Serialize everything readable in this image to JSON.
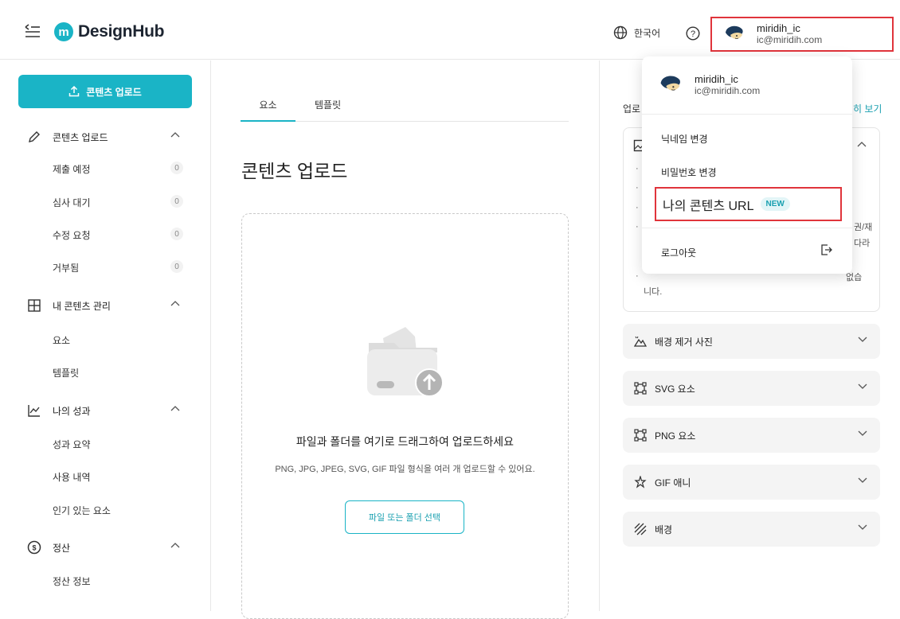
{
  "header": {
    "logo_text": "DesignHub",
    "logo_mark": "m",
    "lang_label": "한국어",
    "user_name": "miridih_ic",
    "user_email": "ic@miridih.com"
  },
  "sidebar": {
    "upload_label": "콘텐츠 업로드",
    "sections": [
      {
        "label": "콘텐츠 업로드",
        "icon": "pencil-icon",
        "items": [
          {
            "label": "제출 예정",
            "count": "0"
          },
          {
            "label": "심사 대기",
            "count": "0"
          },
          {
            "label": "수정 요청",
            "count": "0"
          },
          {
            "label": "거부됨",
            "count": "0"
          }
        ]
      },
      {
        "label": "내 콘텐츠 관리",
        "icon": "grid-icon",
        "items": [
          {
            "label": "요소"
          },
          {
            "label": "템플릿"
          }
        ]
      },
      {
        "label": "나의 성과",
        "icon": "chart-icon",
        "items": [
          {
            "label": "성과 요약"
          },
          {
            "label": "사용 내역"
          },
          {
            "label": "인기 있는 요소"
          }
        ]
      },
      {
        "label": "정산",
        "icon": "coin-icon",
        "items": [
          {
            "label": "정산 정보"
          }
        ]
      }
    ]
  },
  "main": {
    "tabs": [
      "요소",
      "템플릿"
    ],
    "title": "콘텐츠 업로드",
    "dropzone_title": "파일과 폴더를 여기로 드래그하여 업로드하세요",
    "dropzone_sub": "PNG, JPG, JPEG, SVG, GIF 파일 형식을 여러 개 업로드할 수 있어요.",
    "file_button": "파일 또는 폴더 선택"
  },
  "right": {
    "label": "업로",
    "link": "히 보기",
    "frag1": "권/재",
    "frag2": "다라",
    "note": "니다.",
    "note_partial": "없습",
    "accordions": [
      {
        "label": "배경 제거 사진",
        "icon": "mountain-icon"
      },
      {
        "label": "SVG 요소",
        "icon": "vector-frame-icon"
      },
      {
        "label": "PNG 요소",
        "icon": "vector-frame-icon"
      },
      {
        "label": "GIF 애니",
        "icon": "sparkle-icon"
      },
      {
        "label": "배경",
        "icon": "stripes-icon"
      }
    ]
  },
  "dropdown": {
    "user_name": "miridih_ic",
    "user_email": "ic@miridih.com",
    "items": [
      "닉네임 변경",
      "비밀번호 변경",
      "나의 콘텐츠 URL"
    ],
    "new_badge": "NEW",
    "logout": "로그아웃"
  }
}
